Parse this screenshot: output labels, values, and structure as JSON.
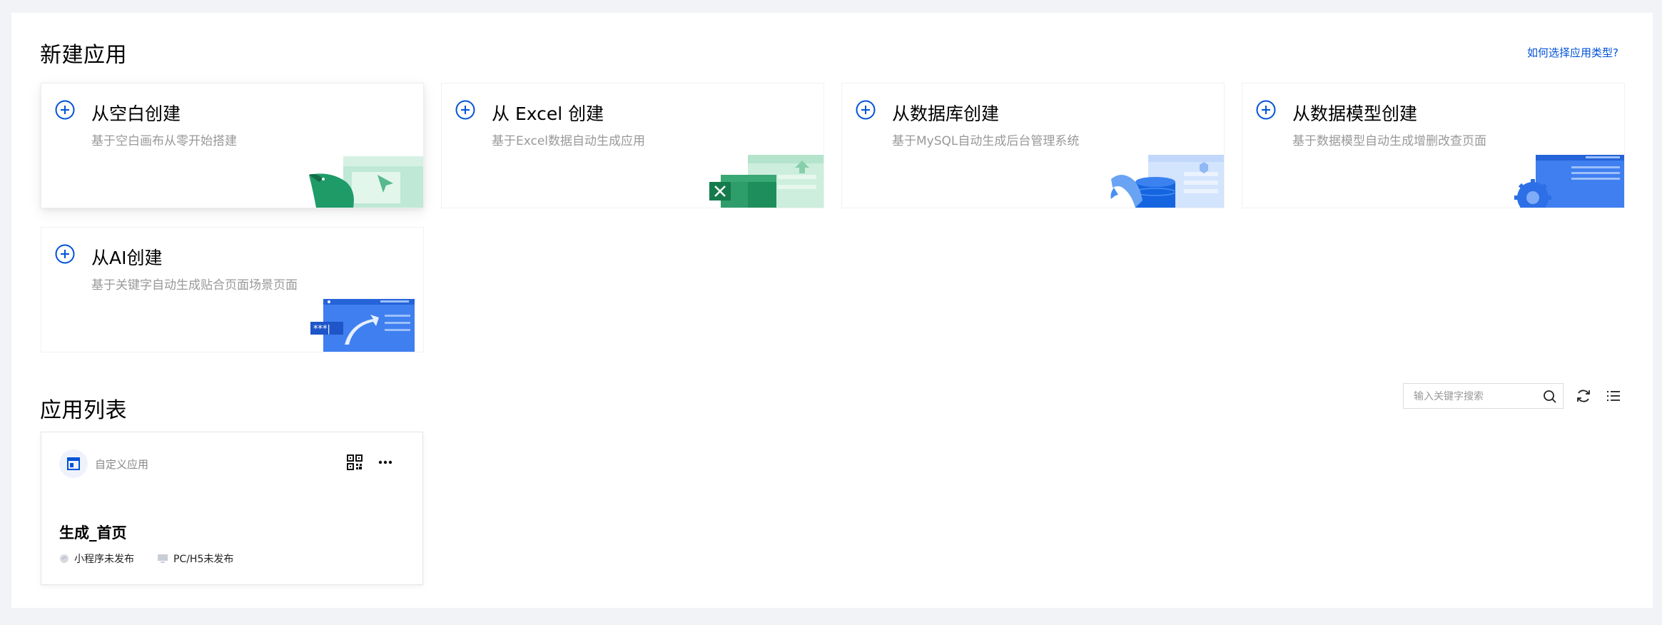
{
  "new_app": {
    "title": "新建应用",
    "help_link": "如何选择应用类型?",
    "options": [
      {
        "title": "从空白创建",
        "desc": "基于空白画布从零开始搭建",
        "icon": "blank-canvas-illustration"
      },
      {
        "title": "从 Excel 创建",
        "desc": "基于Excel数据自动生成应用",
        "icon": "excel-illustration"
      },
      {
        "title": "从数据库创建",
        "desc": "基于MySQL自动生成后台管理系统",
        "icon": "database-illustration"
      },
      {
        "title": "从数据模型创建",
        "desc": "基于数据模型自动生成增删改查页面",
        "icon": "data-model-illustration"
      },
      {
        "title": "从AI创建",
        "desc": "基于关键字自动生成贴合页面场景页面",
        "icon": "ai-illustration",
        "illus_text": "***|"
      }
    ]
  },
  "app_list": {
    "title": "应用列表",
    "search": {
      "placeholder": "输入关键字搜索",
      "value": ""
    },
    "apps": [
      {
        "type": "自定义应用",
        "name": "生成_首页",
        "miniprogram_status": "小程序未发布",
        "pc_status": "PC/H5未发布"
      }
    ]
  },
  "colors": {
    "accent": "#0052d9",
    "excel_green": "#1e8e5c",
    "background": "#f2f3f6"
  }
}
